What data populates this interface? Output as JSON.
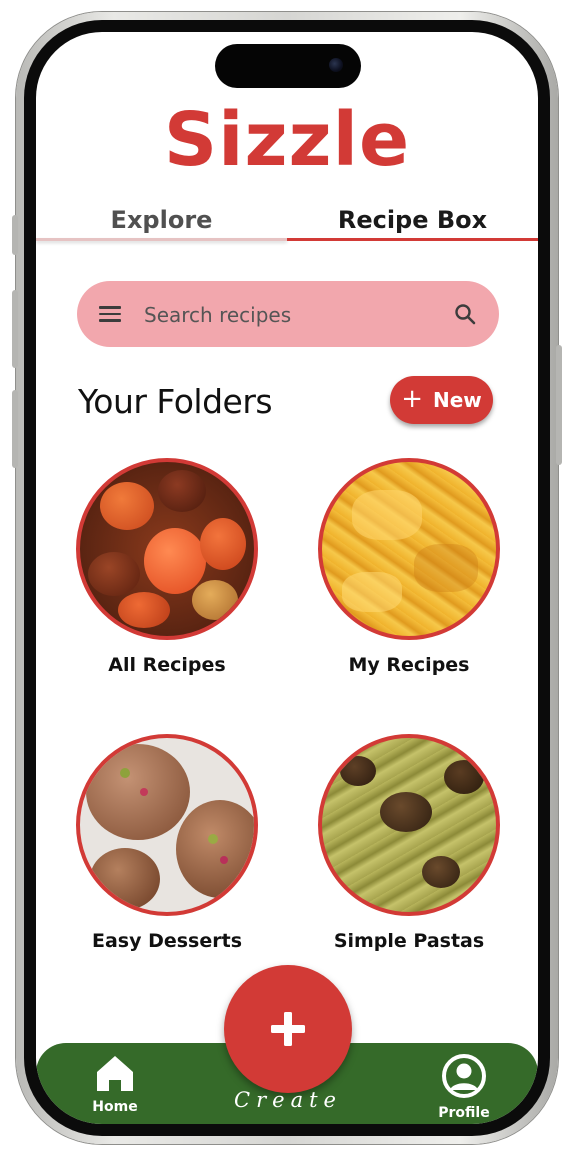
{
  "app": {
    "title": "Sizzle"
  },
  "tabs": [
    {
      "label": "Explore",
      "active": false
    },
    {
      "label": "Recipe Box",
      "active": true
    }
  ],
  "search": {
    "placeholder": "Search recipes",
    "value": ""
  },
  "folders_section": {
    "heading": "Your Folders",
    "new_button_label": "New"
  },
  "folders": [
    {
      "name": "All Recipes",
      "image": "roasted-tomatoes-dish"
    },
    {
      "name": "My Recipes",
      "image": "saffron-pappardelle"
    },
    {
      "name": "Easy Desserts",
      "image": "pistachio-rose-pastries"
    },
    {
      "name": "Simple Pastas",
      "image": "eggplant-pesto-rigatoni"
    }
  ],
  "bottom_nav": {
    "home_label": "Home",
    "create_label": "Create",
    "profile_label": "Profile"
  },
  "colors": {
    "brand_red": "#d23a36",
    "search_pink": "#f2a7ad",
    "nav_green": "#356a29"
  }
}
